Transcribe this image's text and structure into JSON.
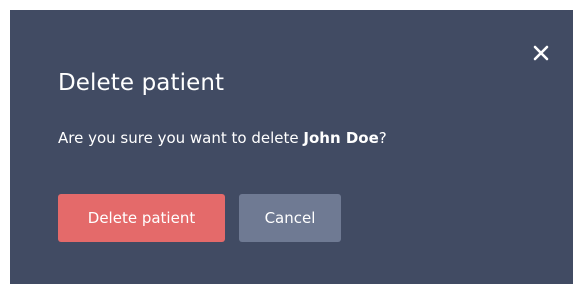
{
  "dialog": {
    "title": "Delete patient",
    "message_prefix": "Are you sure you want to delete ",
    "patient_name": "John Doe",
    "message_suffix": "?",
    "close_icon": "close-icon",
    "buttons": {
      "delete_label": "Delete patient",
      "cancel_label": "Cancel"
    }
  },
  "colors": {
    "dialog_background": "#414b63",
    "delete_button": "#e46a6a",
    "cancel_button": "#6f7a93",
    "text": "#ffffff"
  }
}
